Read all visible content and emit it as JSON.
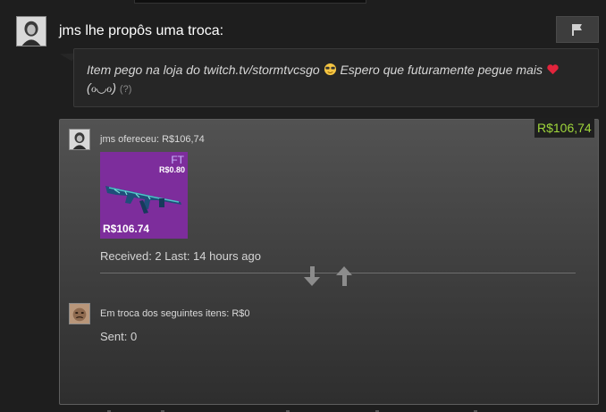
{
  "offer": {
    "title": "jms lhe propôs uma troca:",
    "message_part1": "Item pego na loja do twitch.tv/stormtvcsgo",
    "message_part2": "Espero que futuramente pegue mais",
    "message_part3": "(ℴ◡ℴ)",
    "message_help": "(?)"
  },
  "trade": {
    "total_value": "R$106,74",
    "them_header": "jms ofereceu: R$106,74",
    "them_stats": "Received: 2 Last: 14 hours ago",
    "you_header": "Em troca dos seguintes itens: R$0",
    "you_stats": "Sent: 0"
  },
  "item": {
    "wear": "FT",
    "price_small": "R$0.80",
    "price_big": "R$106.74",
    "tile_color": "#7d2d9c"
  },
  "colors": {
    "value_green": "#9fd63b",
    "panel_top": "#525252"
  },
  "icons": [
    "flag-icon",
    "sunglasses-emoji-icon",
    "heart-emoji-icon",
    "swap-down-arrow-icon",
    "swap-up-arrow-icon",
    "rifle-icon"
  ]
}
